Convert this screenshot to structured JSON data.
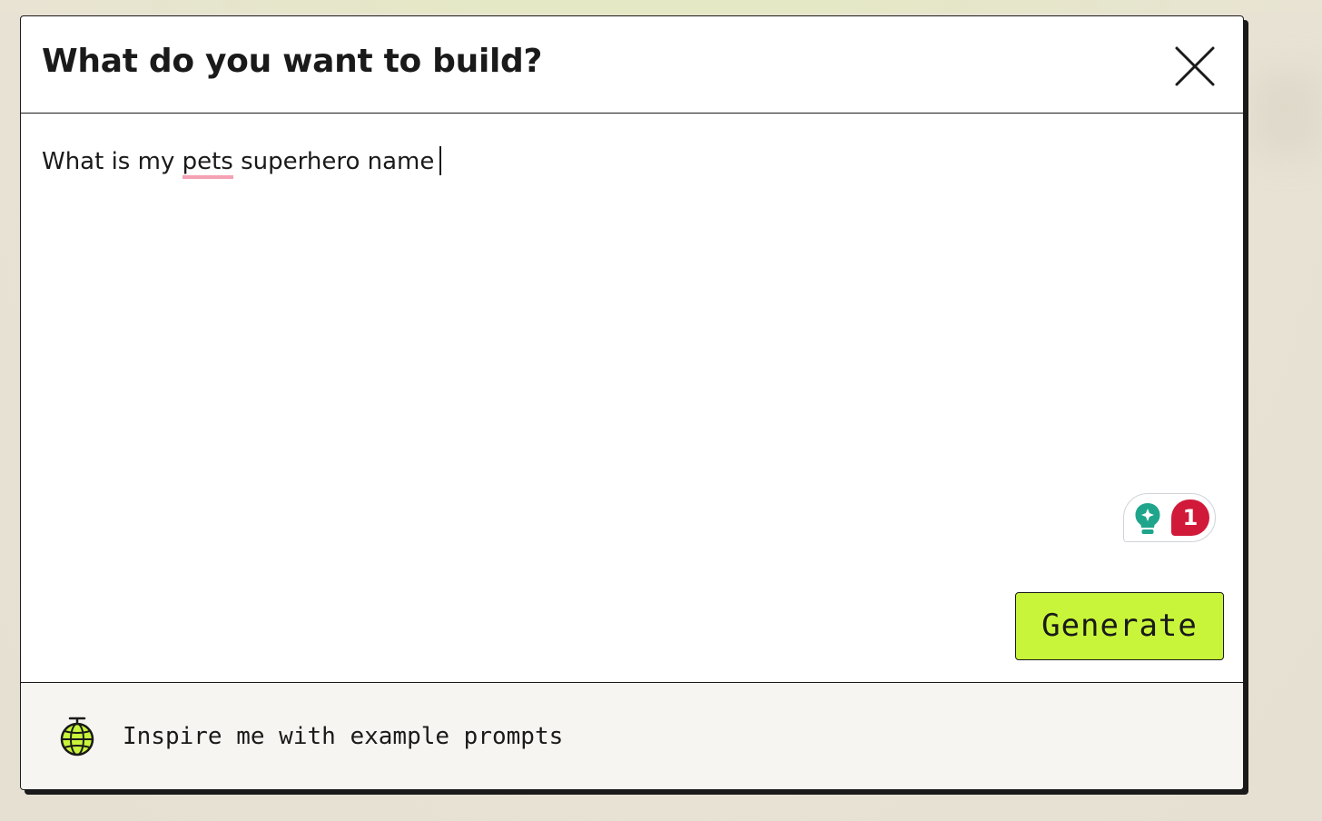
{
  "dialog": {
    "title": "What do you want to build?",
    "close_icon": "close-icon"
  },
  "prompt": {
    "text_before": "What is my ",
    "misspelled_word": "pets",
    "text_after": " superhero name"
  },
  "grammar_widget": {
    "icon": "lightbulb-icon",
    "issue_count": "1",
    "colors": {
      "bulb": "#1fa58b",
      "badge": "#d11a3a"
    }
  },
  "actions": {
    "generate_label": "Generate"
  },
  "footer": {
    "icon": "globe-icon",
    "inspire_label": "Inspire me with example prompts"
  },
  "colors": {
    "accent": "#c8f53a",
    "border": "#1a1a1a",
    "spell_underline": "#f4a0b3"
  }
}
